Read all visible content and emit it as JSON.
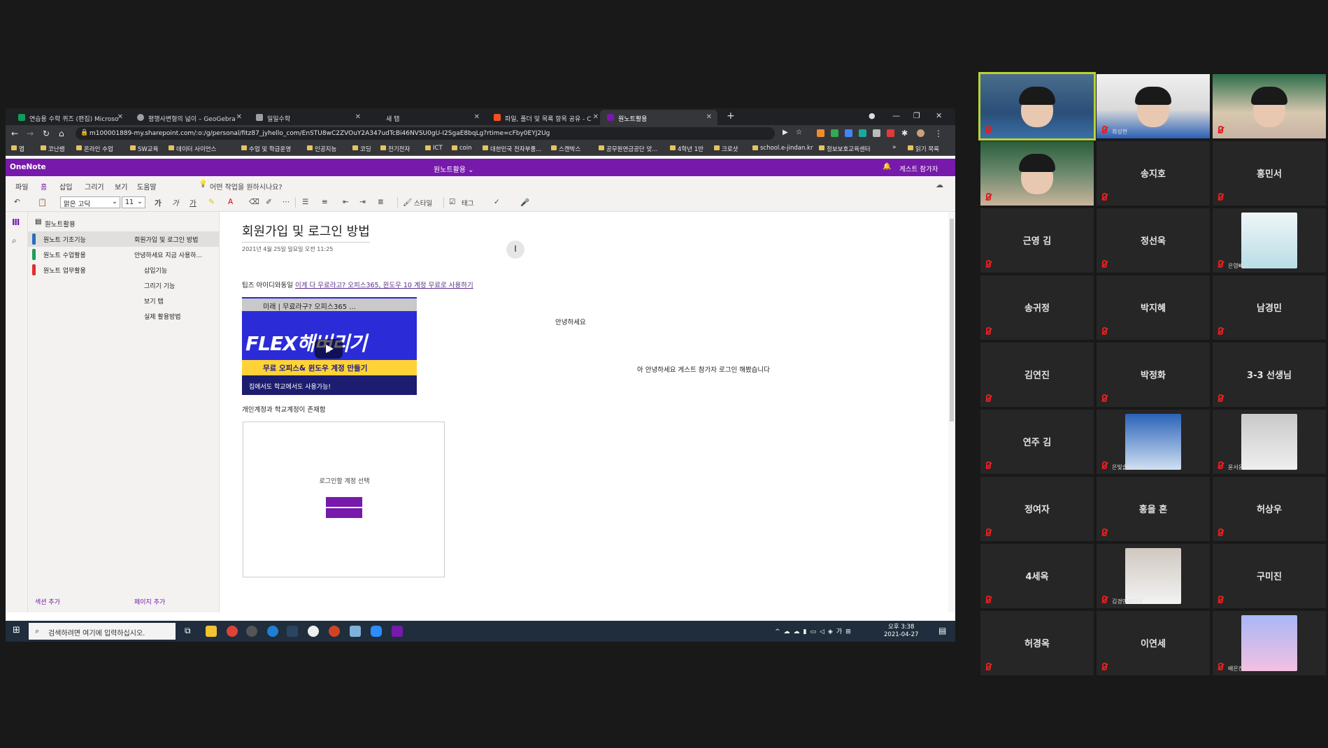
{
  "browser": {
    "tabs": [
      {
        "label": "연습용 수학 퀴즈 (편집) Microso",
        "color": "#0f9d58"
      },
      {
        "label": "평행사변형의 넓이 – GeoGebra",
        "color": "#9aa0a6"
      },
      {
        "label": "일일수학",
        "color": "#9aa0a6"
      },
      {
        "label": "새 탭",
        "color": "#35363a"
      },
      {
        "label": "파일, 폴더 및 목록 항목 공유 - C",
        "color": "#f25022"
      },
      {
        "label": "원노트활용",
        "color": "#7719aa"
      }
    ],
    "new_tab": "+",
    "url": "m100001889-my.sharepoint.com/:o:/g/personal/fitz87_jyhello_com/EnSTU8wC2ZVOuY2A347udTcBi46NVSU0gU-I2SgaE8bqLg?rtime=cFby0EYJ2Ug",
    "bookmarks": [
      "앱",
      "코난쌤",
      "온라인 수업",
      "SW교육",
      "데이터 사이언스",
      "수업 및 학급운영",
      "인공지능",
      "코딩",
      "전기전자",
      "ICT",
      "coin",
      "대한민국 전자부품...",
      "스캔박스",
      "공무원연금공단 맞...",
      "4학년 1반",
      "크로샷",
      "school.e-jindan.kr",
      "정보보호교육센터"
    ],
    "reading_list": "읽기 목록",
    "more": "»"
  },
  "onenote": {
    "brand": "OneNote",
    "notebook_title": "원노트활용 ⌄",
    "guest": "게스트 참가자",
    "menu": [
      "파일",
      "홈",
      "삽입",
      "그리기",
      "보기",
      "도움말"
    ],
    "tell_me": "어떤 작업을 원하시나요?",
    "font_name": "맑은 고딕",
    "font_size": "11",
    "bold": "가",
    "italic": "가",
    "underline": "가",
    "styles": "스타일",
    "tags": "태그",
    "notebook": "원노트활용",
    "sections": [
      {
        "label": "원노트 기초기능",
        "color": "#2a6ebb"
      },
      {
        "label": "원노트 수업활용",
        "color": "#1e9e58"
      },
      {
        "label": "원노트 업무활용",
        "color": "#e0302e"
      }
    ],
    "pages": [
      {
        "label": "회원가입 및 로그인 방법",
        "sub": false
      },
      {
        "label": "안녕하세요 지금 사용하...",
        "sub": false
      },
      {
        "label": "삽입기능",
        "sub": true
      },
      {
        "label": "그리기 기능",
        "sub": true
      },
      {
        "label": "보기 탭",
        "sub": true
      },
      {
        "label": "실제 활용방법",
        "sub": true
      }
    ],
    "add_section": "섹션 추가",
    "add_page": "페이지 추가",
    "page": {
      "title": "회원가입 및  로그인 방법",
      "date": "2021년 4월 25일 일요일     오전 11:25",
      "tip_prefix": "팁즈 아이디와동일 ",
      "tip_link": "이게 다 무료라고? 오피스365, 윈도우 10 계정 무료로 사용하기",
      "video_top": "미래 | 무료라구? 오피스365 ...",
      "video_big": "FLEX해버리기",
      "video_band": "무료 오피스& 윈도우 계정 만들기",
      "video_bottom": "집에서도 학교에서도 사용가능!",
      "account_note": "개인계정과 학교계정이 존재함",
      "login_prompt": "로그인할 계정 선택",
      "hello1": "안녕하세요",
      "hello2": "아 안녕하세요 게스트 참가자 로그인 해봤습니다"
    }
  },
  "taskbar": {
    "search": "검색하려면 여기에 입력하십시오.",
    "time": "오후 3:38",
    "date": "2021-04-27"
  },
  "gallery": {
    "participants": [
      {
        "name": "",
        "label": "",
        "type": "video",
        "active": true
      },
      {
        "name": "",
        "label": "최성현",
        "type": "video",
        "active": false
      },
      {
        "name": "",
        "label": "",
        "type": "video",
        "active": false
      },
      {
        "name": "",
        "label": "",
        "type": "video",
        "active": false
      },
      {
        "name": "송지호",
        "label": "",
        "type": "name",
        "active": false
      },
      {
        "name": "홍민서",
        "label": "",
        "type": "name",
        "active": false
      },
      {
        "name": "근영 김",
        "label": "",
        "type": "name",
        "active": false
      },
      {
        "name": "정선욱",
        "label": "",
        "type": "name",
        "active": false
      },
      {
        "name": "",
        "label": "은영빼기",
        "type": "avatar",
        "active": false
      },
      {
        "name": "송귀정",
        "label": "",
        "type": "name",
        "active": false
      },
      {
        "name": "박지혜",
        "label": "",
        "type": "name",
        "active": false
      },
      {
        "name": "남경민",
        "label": "",
        "type": "name",
        "active": false
      },
      {
        "name": "김연진",
        "label": "",
        "type": "name",
        "active": false
      },
      {
        "name": "박정화",
        "label": "",
        "type": "name",
        "active": false
      },
      {
        "name": "3-3 선생님",
        "label": "",
        "type": "name",
        "active": false
      },
      {
        "name": "연주 김",
        "label": "",
        "type": "name",
        "active": false
      },
      {
        "name": "",
        "label": "은빛솔라나무",
        "type": "avatar",
        "active": false
      },
      {
        "name": "",
        "label": "윤서윤",
        "type": "avatar",
        "active": false
      },
      {
        "name": "정여자",
        "label": "",
        "type": "name",
        "active": false
      },
      {
        "name": "홍을 혼",
        "label": "",
        "type": "name",
        "active": false
      },
      {
        "name": "허상우",
        "label": "",
        "type": "name",
        "active": false
      },
      {
        "name": "4세옥",
        "label": "",
        "type": "name",
        "active": false
      },
      {
        "name": "",
        "label": "김경민라이브",
        "type": "avatar",
        "active": false
      },
      {
        "name": "구미진",
        "label": "",
        "type": "name",
        "active": false
      },
      {
        "name": "허경옥",
        "label": "",
        "type": "name",
        "active": false
      },
      {
        "name": "이연세",
        "label": "",
        "type": "name",
        "active": false
      },
      {
        "name": "",
        "label": "배은진",
        "type": "avatar",
        "active": false
      }
    ]
  }
}
